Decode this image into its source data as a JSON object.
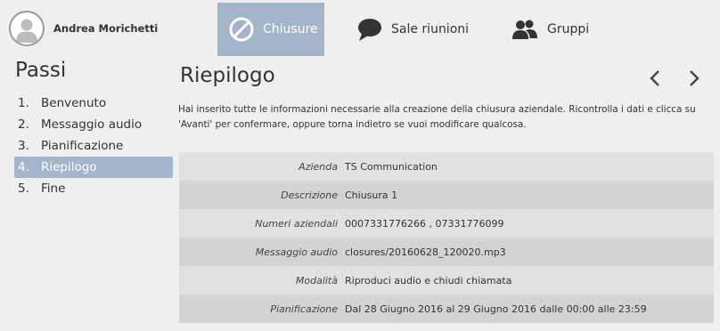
{
  "user": {
    "name": "Andrea Morichetti",
    "avatar_icon": "user-silhouette-icon"
  },
  "nav": {
    "items": [
      {
        "label": "Chiusure",
        "icon": "ban-icon",
        "active": true
      },
      {
        "label": "Sale riunioni",
        "icon": "speech-bubble-icon",
        "active": false
      },
      {
        "label": "Gruppi",
        "icon": "users-icon",
        "active": false
      }
    ],
    "active_color": "#a5b5c9"
  },
  "steps": {
    "title": "Passi",
    "items": [
      {
        "num": "1.",
        "label": "Benvenuto"
      },
      {
        "num": "2.",
        "label": "Messaggio audio"
      },
      {
        "num": "3.",
        "label": "Pianificazione"
      },
      {
        "num": "4.",
        "label": "Riepilogo",
        "active": true
      },
      {
        "num": "5.",
        "label": "Fine"
      }
    ]
  },
  "page": {
    "title": "Riepilogo",
    "intro": "Hai inserito tutte le informazioni necessarie alla creazione della chiusura aziendale. Ricontrolla i dati e clicca su 'Avanti' per confermare, oppure torna indietro se vuoi modificare qualcosa.",
    "prev_icon": "chevron-left-icon",
    "next_icon": "chevron-right-icon"
  },
  "summary": [
    {
      "key": "Azienda",
      "value": "TS Communication"
    },
    {
      "key": "Descrizione",
      "value": "Chiusura 1"
    },
    {
      "key": "Numeri aziendali",
      "value": "0007331776266 , 07331776099"
    },
    {
      "key": "Messaggio audio",
      "value": "closures/20160628_120020.mp3"
    },
    {
      "key": "Modalità",
      "value": "Riproduci audio e chiudi chiamata"
    },
    {
      "key": "Pianificazione",
      "value": "Dal 28 Giugno 2016 al 29 Giugno 2016 dalle 00:00 alle 23:59"
    }
  ]
}
